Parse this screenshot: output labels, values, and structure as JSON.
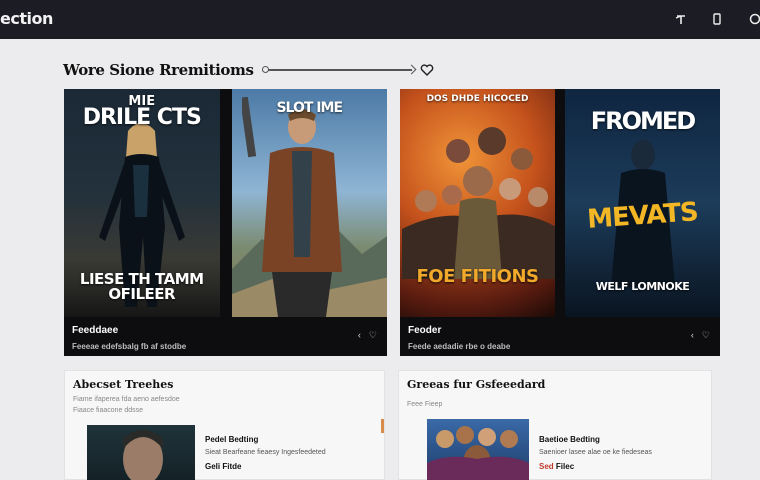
{
  "app": {
    "brand": "ection"
  },
  "topbar": {
    "icons": [
      "pin-icon",
      "phone-icon",
      "search-icon"
    ]
  },
  "section": {
    "title": "Wore Sione Rremitioms",
    "favorite_icon": "heart-icon"
  },
  "featured": [
    {
      "posters": [
        {
          "title": "DRILE CTS",
          "title_top": "MIE",
          "bottom": "LIESE TH TAMM\nOFILEER",
          "palette": "#1a2530"
        },
        {
          "title": "SLOT\nIME",
          "bottom": "",
          "palette": "#6a90b8"
        }
      ],
      "name": "Feeddaee",
      "desc": "Feeeae edefsbalg fb af stodbe",
      "controls": [
        "‹",
        "♡"
      ]
    },
    {
      "posters": [
        {
          "title": "DOS DHDE HICOCED",
          "bottom": "FOE FITIONS",
          "palette": "#c45a1c"
        },
        {
          "title": "FROMED",
          "mid": "MEVATS",
          "bottom": "WELF LOMNOKE",
          "palette": "#1a3050"
        }
      ],
      "name": "Feoder",
      "desc": "Feede aedadie rbe o deabe",
      "controls": [
        "‹",
        "♡"
      ]
    }
  ],
  "cards": [
    {
      "title": "Abecset Treehes",
      "sub": "Fiame ifaperea fda aeno aefesdoe",
      "sub2": "Fiaace fiaacone ddsse",
      "item": {
        "name": "Pedel Bedting",
        "desc": "Sieat Bearfeane fieaesy Ingesfeedeted",
        "price_prefix": "Geli",
        "price": "Fitde"
      }
    },
    {
      "title": "Greeas fur Gsfeeedard",
      "sub": "Feee Fieep",
      "sub2": "",
      "item": {
        "name": "Baetioe Bedting",
        "desc": "Saenioer lasee alae oe ke fiedeseas",
        "price_prefix": "Sed",
        "price": "Filec"
      }
    }
  ]
}
